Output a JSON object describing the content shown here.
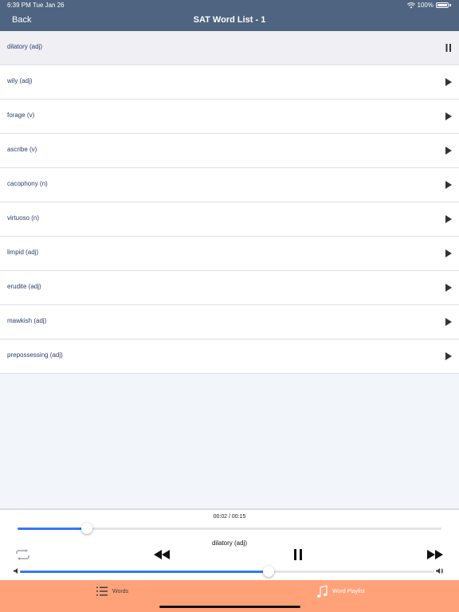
{
  "status_bar": {
    "time": "6:39 PM  Tue Jan 26",
    "battery": "100%"
  },
  "nav": {
    "back_label": "Back",
    "title": "SAT Word List - 1"
  },
  "words": [
    {
      "label": "dilatory (adj)",
      "state": "playing"
    },
    {
      "label": "wily (adj)",
      "state": "idle"
    },
    {
      "label": "forage (v)",
      "state": "idle"
    },
    {
      "label": "ascribe (v)",
      "state": "idle"
    },
    {
      "label": "cacophony (n)",
      "state": "idle"
    },
    {
      "label": "virtuoso (n)",
      "state": "idle"
    },
    {
      "label": "limpid (adj)",
      "state": "idle"
    },
    {
      "label": "erudite (adj)",
      "state": "idle"
    },
    {
      "label": "mawkish (adj)",
      "state": "idle"
    },
    {
      "label": "prepossessing (adj)",
      "state": "idle"
    }
  ],
  "player": {
    "time_readout": "00:02 / 00:15",
    "progress_fraction": 0.163,
    "now_playing": "dilatory (adj)",
    "volume_fraction": 0.6,
    "icons": [
      "repeat-icon",
      "rewind-icon",
      "pause-icon",
      "fast-forward-icon",
      "volume-low-icon",
      "volume-high-icon"
    ]
  },
  "tabs": [
    {
      "label": "Words",
      "icon": "list-icon",
      "selected": false
    },
    {
      "label": "Word Playlist",
      "icon": "music-note-icon",
      "selected": true
    }
  ],
  "colors": {
    "nav_bar": "#4e6480",
    "accent": "#3478f6",
    "tab_bar": "#ffa27a",
    "word_text": "#2c3d6b"
  }
}
